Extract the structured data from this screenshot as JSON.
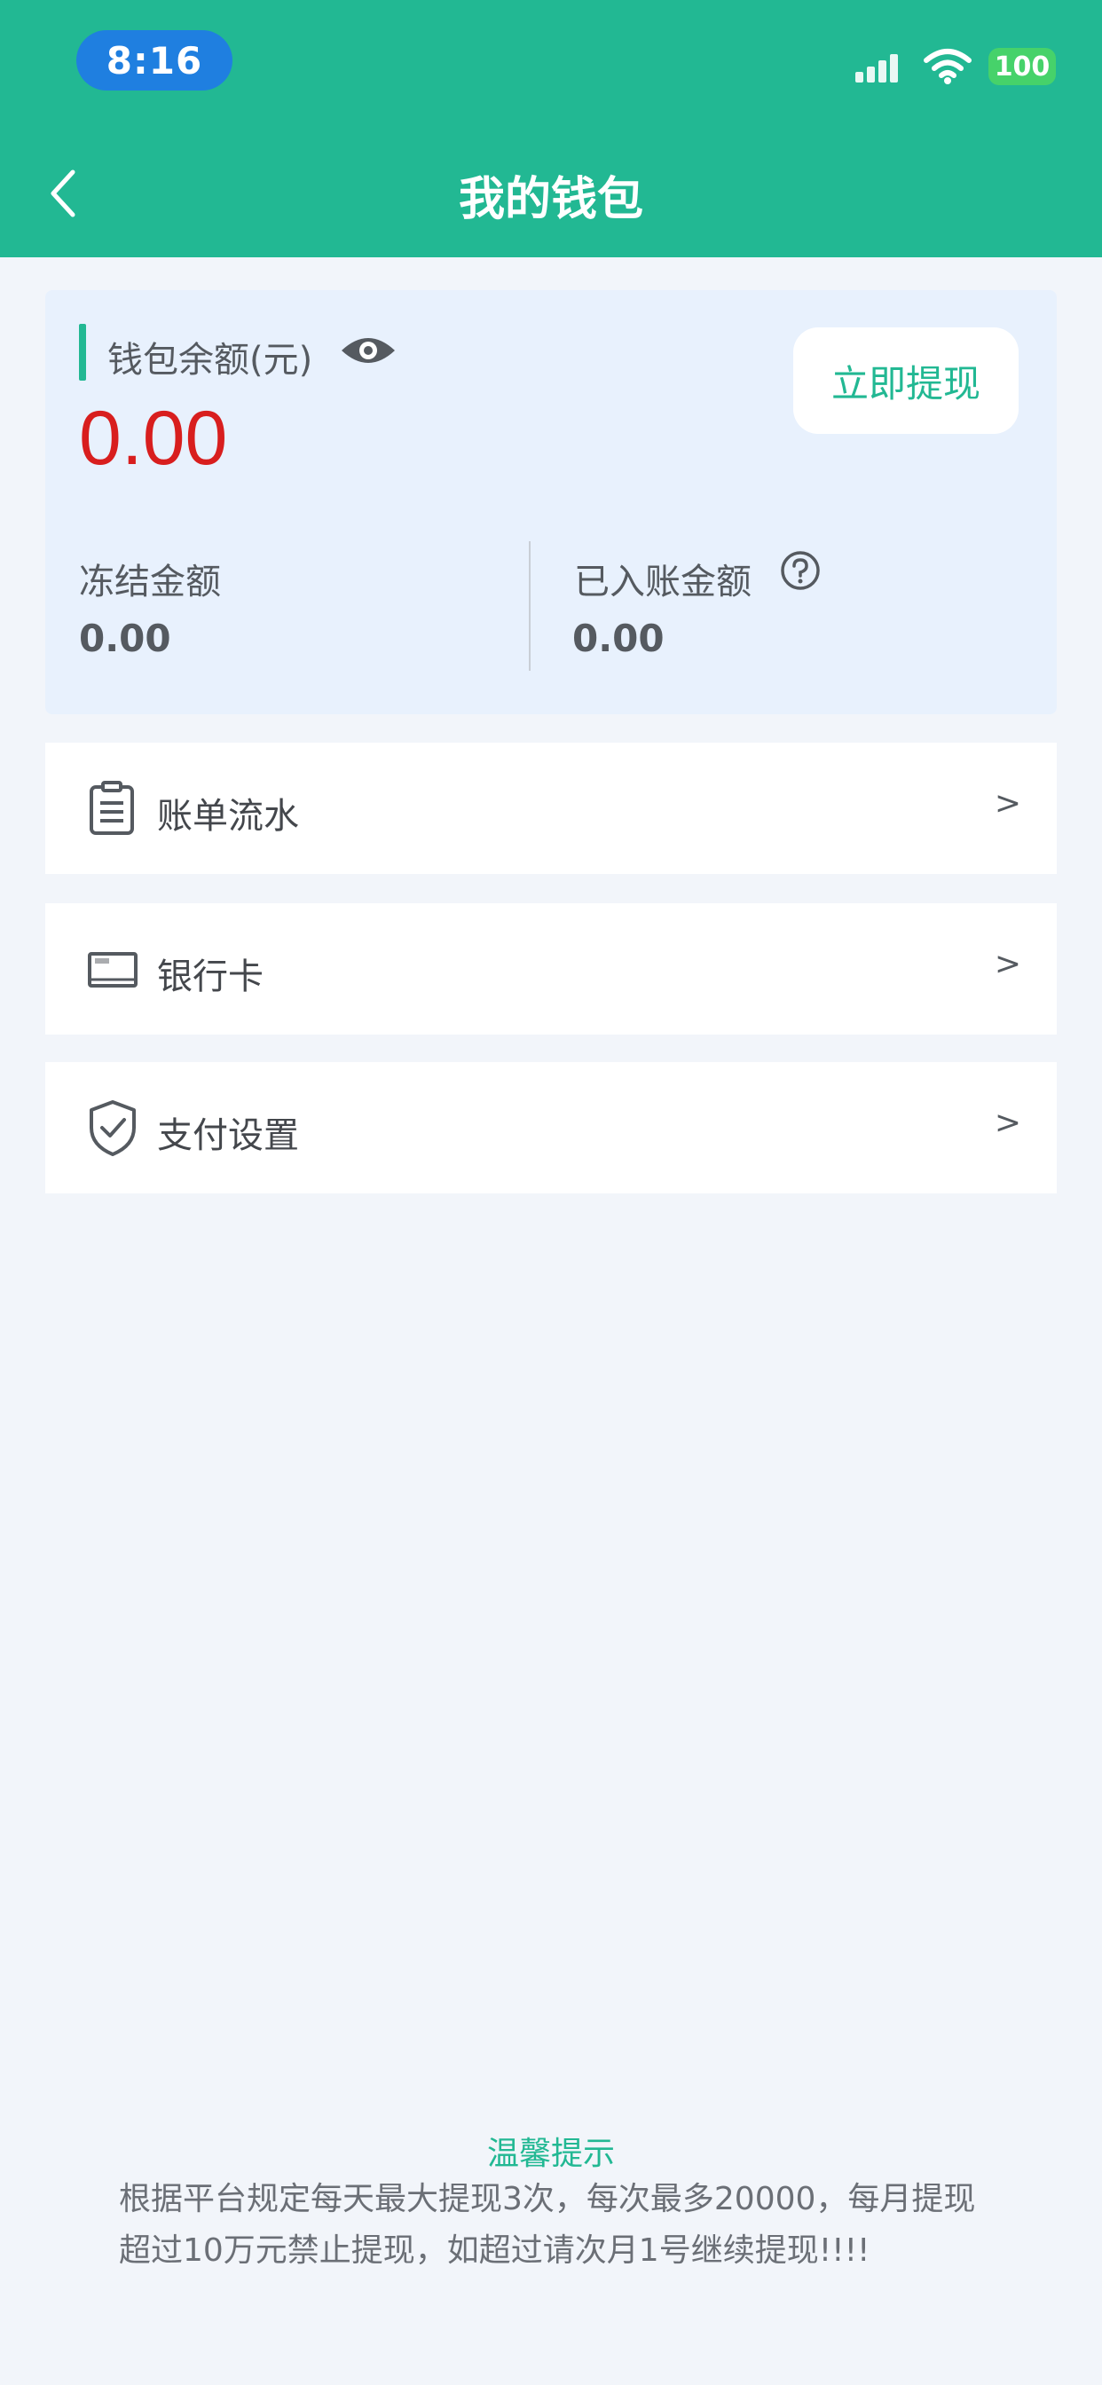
{
  "status_bar": {
    "time": "8:16",
    "battery": "100",
    "icons": [
      "signal-icon",
      "wifi-icon",
      "battery-icon"
    ]
  },
  "header": {
    "title": "我的钱包",
    "back_icon": "back-chevron-icon"
  },
  "wallet": {
    "balance_label": "钱包余额(元)",
    "balance_amount": "0.00",
    "withdraw_label": "立即提现",
    "frozen_label": "冻结金额",
    "frozen_value": "0.00",
    "credited_label": "已入账金额",
    "credited_value": "0.00"
  },
  "menu": [
    {
      "label": "账单流水",
      "icon": "bill-icon",
      "arrow": ">"
    },
    {
      "label": "银行卡",
      "icon": "bank-card-icon",
      "arrow": ">"
    },
    {
      "label": "支付设置",
      "icon": "shield-check-icon",
      "arrow": ">"
    }
  ],
  "tips": {
    "title": "温馨提示",
    "text": "根据平台规定每天最大提现3次，每次最多20000，每月提现超过10万元禁止提现，如超过请次月1号继续提现!!!!"
  },
  "colors": {
    "primary": "#22b893",
    "amount_red": "#d81e1e",
    "time_pill": "#1f7fe0",
    "page_bg": "#f2f5fa",
    "card_bg": "#e8f1fd"
  }
}
